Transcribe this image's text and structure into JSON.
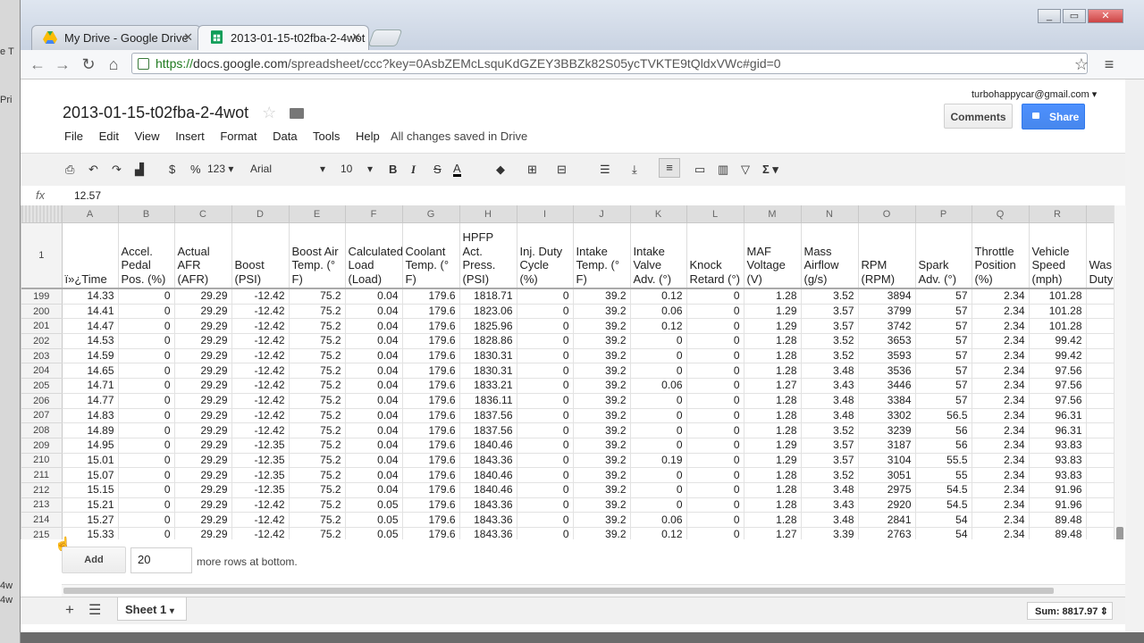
{
  "left_edge": {
    "fragments": [
      "e T",
      "Pri",
      "4w",
      "4w"
    ]
  },
  "window": {
    "controls": [
      "_",
      "▭",
      "✕"
    ]
  },
  "tabs": [
    {
      "label": "My Drive - Google Drive",
      "icon": "google-drive-icon"
    },
    {
      "label": "2013-01-15-t02fba-2-4wot",
      "icon": "sheets-icon"
    }
  ],
  "nav": {
    "url_scheme": "https://",
    "url_host": "docs.google.com",
    "url_path": "/spreadsheet/ccc?key=0AsbZEMcLsquKdGZEY3BBZk82S05ycTVKTE9tQldxVWc#gid=0"
  },
  "doc": {
    "title": "2013-01-15-t02fba-2-4wot",
    "account": "turbohappycar@gmail.com",
    "comments_label": "Comments",
    "share_label": "Share",
    "menu": [
      "File",
      "Edit",
      "View",
      "Insert",
      "Format",
      "Data",
      "Tools",
      "Help"
    ],
    "status": "All changes saved in Drive"
  },
  "format_toolbar": {
    "currency": "$",
    "percent": "%",
    "number_format": "123",
    "font": "Arial",
    "font_size": "10",
    "bold": "B",
    "italic": "I",
    "strike": "S",
    "text_color": "A",
    "sum": "Σ"
  },
  "formula_bar": {
    "fx": "fx",
    "value": "12.57"
  },
  "grid": {
    "column_letters": [
      "A",
      "B",
      "C",
      "D",
      "E",
      "F",
      "G",
      "H",
      "I",
      "J",
      "K",
      "L",
      "M",
      "N",
      "O",
      "P",
      "Q",
      "R",
      ""
    ],
    "header_row_number": "1",
    "headers": [
      "ï»¿Time",
      "Accel. Pedal Pos. (%)",
      "Actual AFR (AFR)",
      "Boost (PSI)",
      "Boost Air Temp. (° F)",
      "Calculated Load (Load)",
      "Coolant Temp. (° F)",
      "HPFP Act. Press. (PSI)",
      "Inj. Duty Cycle (%)",
      "Intake Temp. (° F)",
      "Intake Valve Adv. (°)",
      "Knock Retard (°)",
      "MAF Voltage (V)",
      "Mass Airflow (g/s)",
      "RPM (RPM)",
      "Spark Adv. (°)",
      "Throttle Position (%)",
      "Vehicle Speed (mph)",
      "Was Duty"
    ],
    "rows": [
      {
        "n": "199",
        "v": [
          "14.33",
          "0",
          "29.29",
          "-12.42",
          "75.2",
          "0.04",
          "179.6",
          "1818.71",
          "0",
          "39.2",
          "0.12",
          "0",
          "1.28",
          "3.52",
          "3894",
          "57",
          "2.34",
          "101.28",
          ""
        ]
      },
      {
        "n": "200",
        "v": [
          "14.41",
          "0",
          "29.29",
          "-12.42",
          "75.2",
          "0.04",
          "179.6",
          "1823.06",
          "0",
          "39.2",
          "0.06",
          "0",
          "1.29",
          "3.57",
          "3799",
          "57",
          "2.34",
          "101.28",
          ""
        ]
      },
      {
        "n": "201",
        "v": [
          "14.47",
          "0",
          "29.29",
          "-12.42",
          "75.2",
          "0.04",
          "179.6",
          "1825.96",
          "0",
          "39.2",
          "0.12",
          "0",
          "1.29",
          "3.57",
          "3742",
          "57",
          "2.34",
          "101.28",
          ""
        ]
      },
      {
        "n": "202",
        "v": [
          "14.53",
          "0",
          "29.29",
          "-12.42",
          "75.2",
          "0.04",
          "179.6",
          "1828.86",
          "0",
          "39.2",
          "0",
          "0",
          "1.28",
          "3.52",
          "3653",
          "57",
          "2.34",
          "99.42",
          ""
        ]
      },
      {
        "n": "203",
        "v": [
          "14.59",
          "0",
          "29.29",
          "-12.42",
          "75.2",
          "0.04",
          "179.6",
          "1830.31",
          "0",
          "39.2",
          "0",
          "0",
          "1.28",
          "3.52",
          "3593",
          "57",
          "2.34",
          "99.42",
          ""
        ]
      },
      {
        "n": "204",
        "v": [
          "14.65",
          "0",
          "29.29",
          "-12.42",
          "75.2",
          "0.04",
          "179.6",
          "1830.31",
          "0",
          "39.2",
          "0",
          "0",
          "1.28",
          "3.48",
          "3536",
          "57",
          "2.34",
          "97.56",
          ""
        ]
      },
      {
        "n": "205",
        "v": [
          "14.71",
          "0",
          "29.29",
          "-12.42",
          "75.2",
          "0.04",
          "179.6",
          "1833.21",
          "0",
          "39.2",
          "0.06",
          "0",
          "1.27",
          "3.43",
          "3446",
          "57",
          "2.34",
          "97.56",
          ""
        ]
      },
      {
        "n": "206",
        "v": [
          "14.77",
          "0",
          "29.29",
          "-12.42",
          "75.2",
          "0.04",
          "179.6",
          "1836.11",
          "0",
          "39.2",
          "0",
          "0",
          "1.28",
          "3.48",
          "3384",
          "57",
          "2.34",
          "97.56",
          ""
        ]
      },
      {
        "n": "207",
        "v": [
          "14.83",
          "0",
          "29.29",
          "-12.42",
          "75.2",
          "0.04",
          "179.6",
          "1837.56",
          "0",
          "39.2",
          "0",
          "0",
          "1.28",
          "3.48",
          "3302",
          "56.5",
          "2.34",
          "96.31",
          ""
        ]
      },
      {
        "n": "208",
        "v": [
          "14.89",
          "0",
          "29.29",
          "-12.42",
          "75.2",
          "0.04",
          "179.6",
          "1837.56",
          "0",
          "39.2",
          "0",
          "0",
          "1.28",
          "3.52",
          "3239",
          "56",
          "2.34",
          "96.31",
          ""
        ]
      },
      {
        "n": "209",
        "v": [
          "14.95",
          "0",
          "29.29",
          "-12.35",
          "75.2",
          "0.04",
          "179.6",
          "1840.46",
          "0",
          "39.2",
          "0",
          "0",
          "1.29",
          "3.57",
          "3187",
          "56",
          "2.34",
          "93.83",
          ""
        ]
      },
      {
        "n": "210",
        "v": [
          "15.01",
          "0",
          "29.29",
          "-12.35",
          "75.2",
          "0.04",
          "179.6",
          "1843.36",
          "0",
          "39.2",
          "0.19",
          "0",
          "1.29",
          "3.57",
          "3104",
          "55.5",
          "2.34",
          "93.83",
          ""
        ]
      },
      {
        "n": "211",
        "v": [
          "15.07",
          "0",
          "29.29",
          "-12.35",
          "75.2",
          "0.04",
          "179.6",
          "1840.46",
          "0",
          "39.2",
          "0",
          "0",
          "1.28",
          "3.52",
          "3051",
          "55",
          "2.34",
          "93.83",
          ""
        ]
      },
      {
        "n": "212",
        "v": [
          "15.15",
          "0",
          "29.29",
          "-12.35",
          "75.2",
          "0.04",
          "179.6",
          "1840.46",
          "0",
          "39.2",
          "0",
          "0",
          "1.28",
          "3.48",
          "2975",
          "54.5",
          "2.34",
          "91.96",
          ""
        ]
      },
      {
        "n": "213",
        "v": [
          "15.21",
          "0",
          "29.29",
          "-12.42",
          "75.2",
          "0.05",
          "179.6",
          "1843.36",
          "0",
          "39.2",
          "0",
          "0",
          "1.28",
          "3.43",
          "2920",
          "54.5",
          "2.34",
          "91.96",
          ""
        ]
      },
      {
        "n": "214",
        "v": [
          "15.27",
          "0",
          "29.29",
          "-12.42",
          "75.2",
          "0.05",
          "179.6",
          "1843.36",
          "0",
          "39.2",
          "0.06",
          "0",
          "1.28",
          "3.48",
          "2841",
          "54",
          "2.34",
          "89.48",
          ""
        ]
      },
      {
        "n": "215",
        "v": [
          "15.33",
          "0",
          "29.29",
          "-12.42",
          "75.2",
          "0.05",
          "179.6",
          "1843.36",
          "0",
          "39.2",
          "0.12",
          "0",
          "1.27",
          "3.39",
          "2763",
          "54",
          "2.34",
          "89.48",
          ""
        ]
      }
    ]
  },
  "add_rows": {
    "button": "Add",
    "count": "20",
    "suffix": "more rows at bottom."
  },
  "sheets": {
    "active": "Sheet 1",
    "sum": "Sum: 8817.97"
  },
  "colors": {
    "share_blue": "#4d90fe",
    "secure_green": "#1f7a1f",
    "header_gray": "#dedede"
  }
}
